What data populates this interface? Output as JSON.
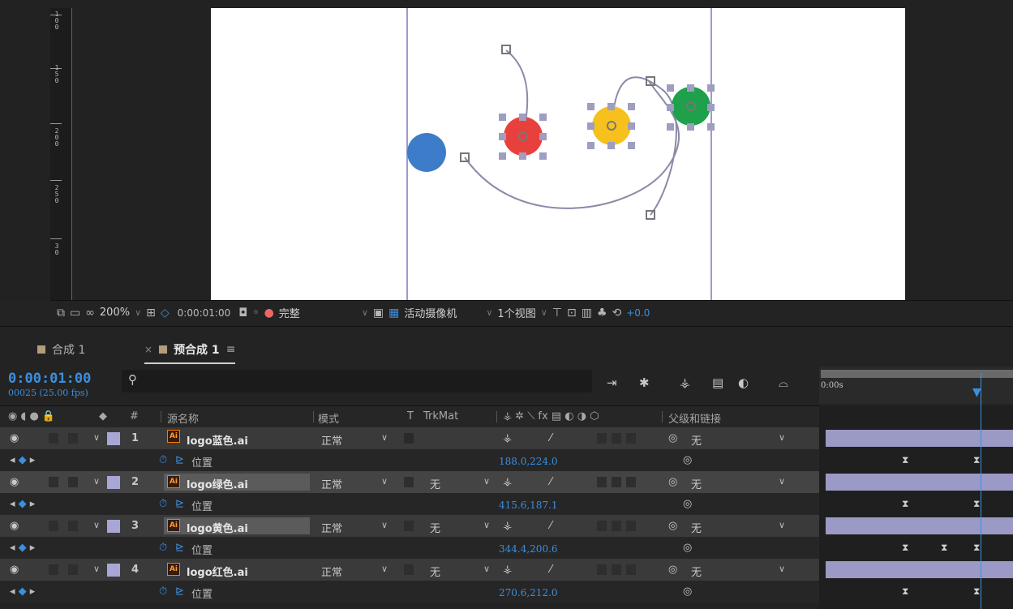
{
  "ruler": {
    "labels": [
      "1\n0\n0",
      "1\n5\n0",
      "2\n0\n0",
      "2\n5\n0",
      "3\n0"
    ]
  },
  "viewer_toolbar": {
    "zoom": "200%",
    "time": "0:00:01:00",
    "resolution": "完整",
    "camera": "活动摄像机",
    "views": "1个视图",
    "exposure": "+0.0"
  },
  "tabs": [
    {
      "label": "合成 1",
      "swatch": "#b49b7c"
    },
    {
      "label": "预合成 1",
      "swatch": "#b49b7c"
    }
  ],
  "timeline": {
    "timecode": "0:00:01:00",
    "fps": "00025 (25.00 fps)",
    "ruler_label": "0:00s"
  },
  "columns": {
    "hash": "#",
    "source": "源名称",
    "mode": "模式",
    "t": "T",
    "trkmat": "TrkMat",
    "parent": "父级和链接"
  },
  "layers": [
    {
      "num": "1",
      "name": "logo蓝色.ai",
      "mode": "正常",
      "trkmat": "",
      "parent": "无",
      "prop": "位置",
      "value": "188.0,224.0"
    },
    {
      "num": "2",
      "name": "logo绿色.ai",
      "mode": "正常",
      "trkmat": "无",
      "parent": "无",
      "prop": "位置",
      "value": "415.6,187.1"
    },
    {
      "num": "3",
      "name": "logo黄色.ai",
      "mode": "正常",
      "trkmat": "无",
      "parent": "无",
      "prop": "位置",
      "value": "344.4,200.6"
    },
    {
      "num": "4",
      "name": "logo红色.ai",
      "mode": "正常",
      "trkmat": "无",
      "parent": "无",
      "prop": "位置",
      "value": "270.6,212.0"
    }
  ],
  "colors": {
    "accent": "#3b8fe0",
    "blue_logo": "#3d7cc9",
    "red_logo": "#e8413d",
    "yellow_logo": "#f7c11d",
    "green_logo": "#1fa04a",
    "label_lavender": "#a8a6d6"
  }
}
